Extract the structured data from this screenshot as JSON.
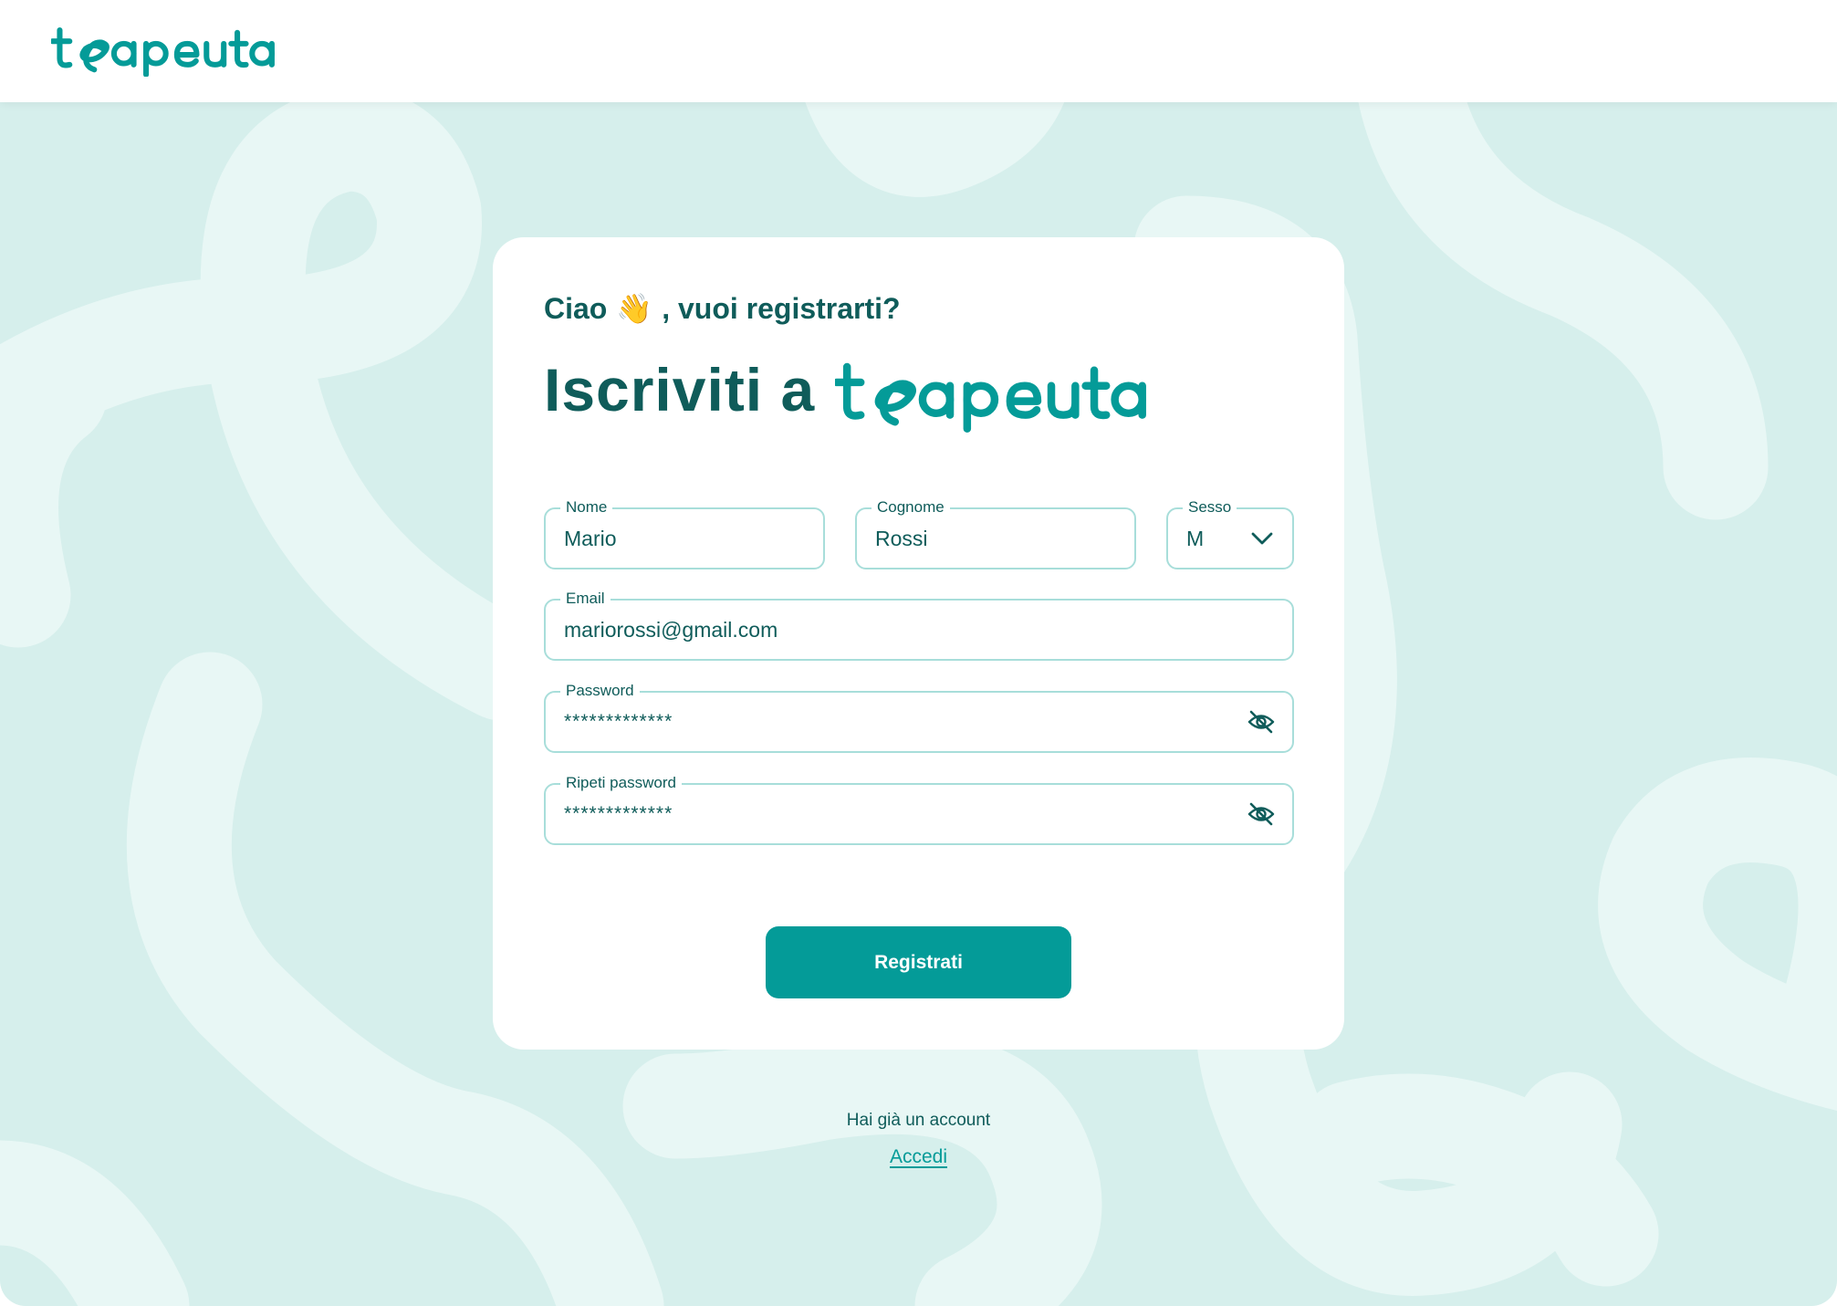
{
  "brand": {
    "name": "terapeuta",
    "primary": "#049b98",
    "dark": "#0f5c5a",
    "background": "#d6efec"
  },
  "card": {
    "greeting_before": "Ciao",
    "greeting_emoji": "👋",
    "greeting_after": ", vuoi registrarti?",
    "headline": "Iscriviti a"
  },
  "form": {
    "nome": {
      "label": "Nome",
      "value": "Mario"
    },
    "cognome": {
      "label": "Cognome",
      "value": "Rossi"
    },
    "sesso": {
      "label": "Sesso",
      "value": "M",
      "icon": "chevron-down-icon"
    },
    "email": {
      "label": "Email",
      "value": "mariorossi@gmail.com"
    },
    "password": {
      "label": "Password",
      "value": "*************",
      "icon": "eye-off-icon"
    },
    "ripeti_password": {
      "label": "Ripeti password",
      "value": "*************",
      "icon": "eye-off-icon"
    },
    "submit_label": "Registrati"
  },
  "footer": {
    "question": "Hai già un account",
    "login_link": "Accedi"
  }
}
